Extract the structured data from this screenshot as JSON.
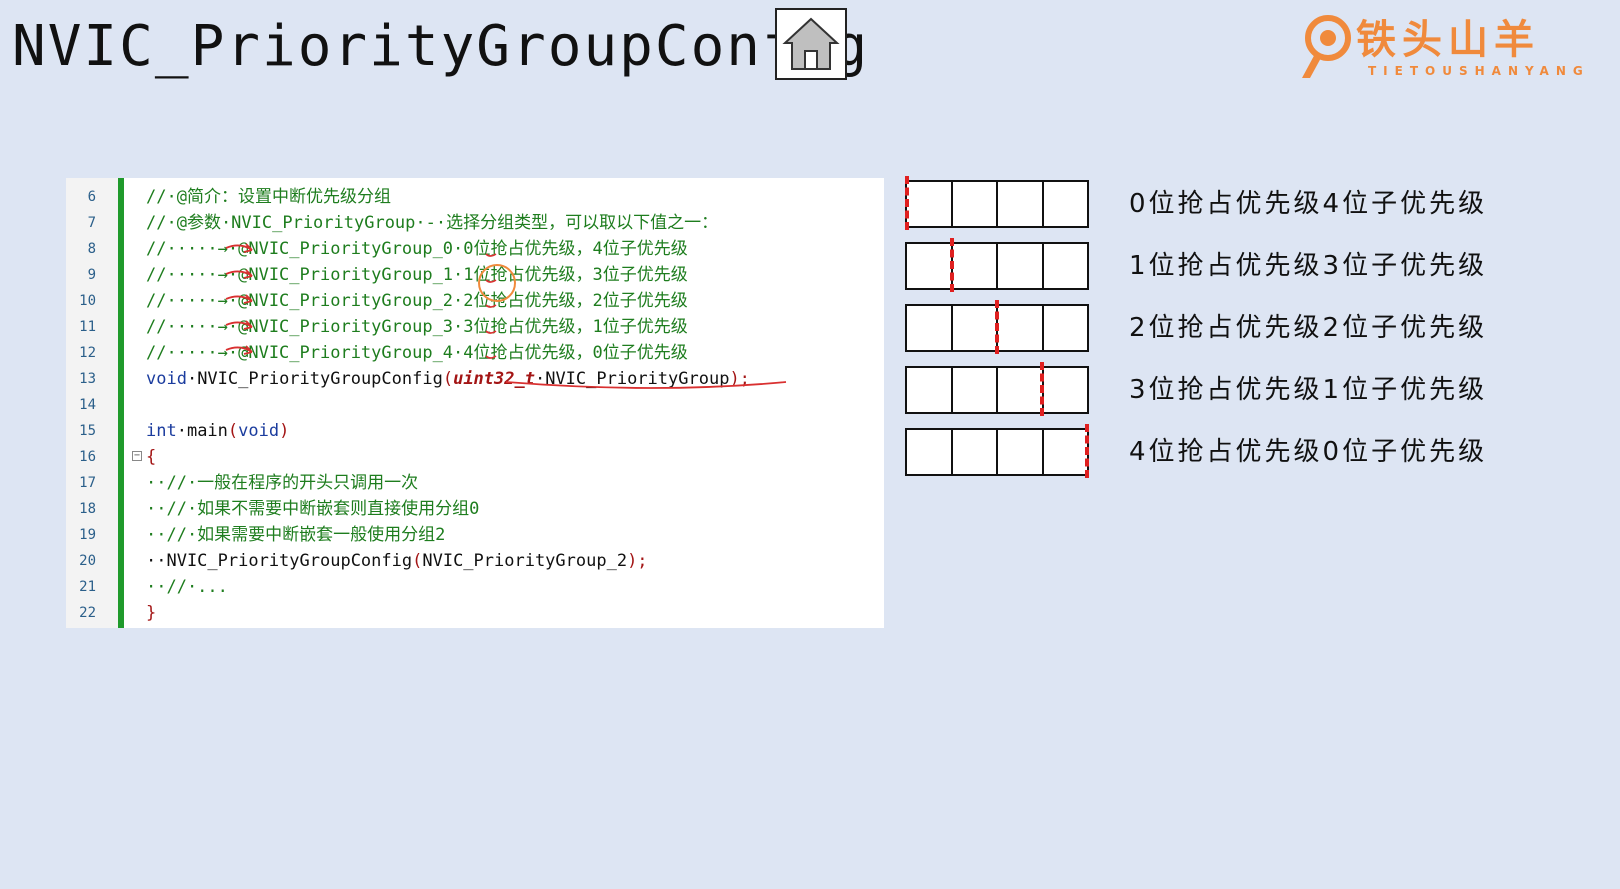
{
  "title": "NVIC_PriorityGroupConfig",
  "home_icon": "home-icon",
  "logo": {
    "text": "铁头山羊",
    "subtitle": "TIETOUSHANYANG",
    "color": "#f08a3c"
  },
  "code": {
    "lines": [
      {
        "no": "6",
        "text": "//·@简介：设置中断优先级分组"
      },
      {
        "no": "7",
        "text": "//·@参数·NVIC_PriorityGroup·-·选择分组类型，可以取以下值之一："
      },
      {
        "no": "8",
        "text": "//·····→·@NVIC_PriorityGroup_0·0位抢占优先级，4位子优先级"
      },
      {
        "no": "9",
        "text": "//·····→·@NVIC_PriorityGroup_1·1位抢占优先级，3位子优先级"
      },
      {
        "no": "10",
        "text": "//·····→·@NVIC_PriorityGroup_2·2位抢占优先级，2位子优先级"
      },
      {
        "no": "11",
        "text": "//·····→·@NVIC_PriorityGroup_3·3位抢占优先级，1位子优先级"
      },
      {
        "no": "12",
        "text": "//·····→·@NVIC_PriorityGroup_4·4位抢占优先级，0位子优先级"
      },
      {
        "no": "13",
        "kw": "void",
        "fn": "·NVIC_PriorityGroupConfig",
        "p1": "(",
        "type": "uint32_t",
        "arg": "·NVIC_PriorityGroup",
        "p2": ");"
      },
      {
        "no": "14",
        "text": ""
      },
      {
        "no": "15",
        "kw": "int",
        "fn": "·main",
        "p1": "(",
        "type2": "void",
        "p2": ")"
      },
      {
        "no": "16",
        "text": "{"
      },
      {
        "no": "17",
        "text": "··//·一般在程序的开头只调用一次"
      },
      {
        "no": "18",
        "text": "··//·如果不需要中断嵌套则直接使用分组0"
      },
      {
        "no": "19",
        "text": "··//·如果需要中断嵌套一般使用分组2"
      },
      {
        "no": "20",
        "fn": "··NVIC_PriorityGroupConfig",
        "p1": "(",
        "arg": "NVIC_PriorityGroup_2",
        "p2": ");"
      },
      {
        "no": "21",
        "text": "··//·..."
      },
      {
        "no": "22",
        "text": "}"
      }
    ]
  },
  "groups": [
    {
      "preempt_bits": 0,
      "label": "0位抢占优先级4位子优先级"
    },
    {
      "preempt_bits": 1,
      "label": "1位抢占优先级3位子优先级"
    },
    {
      "preempt_bits": 2,
      "label": "2位抢占优先级2位子优先级"
    },
    {
      "preempt_bits": 3,
      "label": "3位抢占优先级1位子优先级"
    },
    {
      "preempt_bits": 4,
      "label": "4位抢占优先级0位子优先级"
    }
  ],
  "colors": {
    "background": "#dde5f3",
    "comment": "#1e7d1e",
    "keyword": "#1b3c9e",
    "type": "#a31515",
    "split_mark": "#e02020",
    "gutter_bar": "#1f9a2b"
  }
}
